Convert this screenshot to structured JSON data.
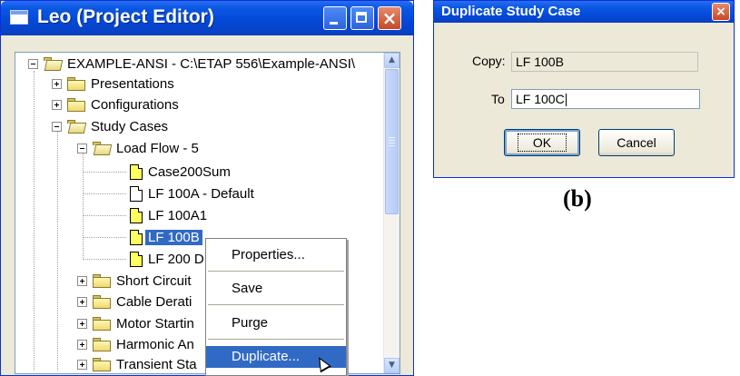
{
  "project_window": {
    "title": "Leo (Project Editor)",
    "controls": {
      "minimize": "minimize-icon",
      "maximize": "maximize-icon",
      "close": "×"
    },
    "tree": {
      "root": "EXAMPLE-ANSI - C:\\ETAP 556\\Example-ANSI\\",
      "presentations": "Presentations",
      "configurations": "Configurations",
      "study_cases": "Study Cases",
      "load_flow": "Load Flow - 5",
      "lf_items": [
        "Case200Sum",
        "LF 100A - Default",
        "LF 100A1",
        "LF 100B",
        "LF 200 D"
      ],
      "selected": "LF 100B",
      "other_folders": [
        "Short Circuit",
        "Cable Derati",
        "Motor Startin",
        "Harmonic An",
        "Transient Sta"
      ]
    }
  },
  "context_menu": {
    "items": [
      "Properties...",
      "Save",
      "Purge",
      "Duplicate..."
    ],
    "highlighted": "Duplicate..."
  },
  "dialog": {
    "title": "Duplicate Study Case",
    "copy_label": "Copy:",
    "copy_value": "LF 100B",
    "to_label": "To",
    "to_value": "LF 100C",
    "ok_label": "OK",
    "cancel_label": "Cancel",
    "close": "×"
  },
  "caption": "(b)"
}
